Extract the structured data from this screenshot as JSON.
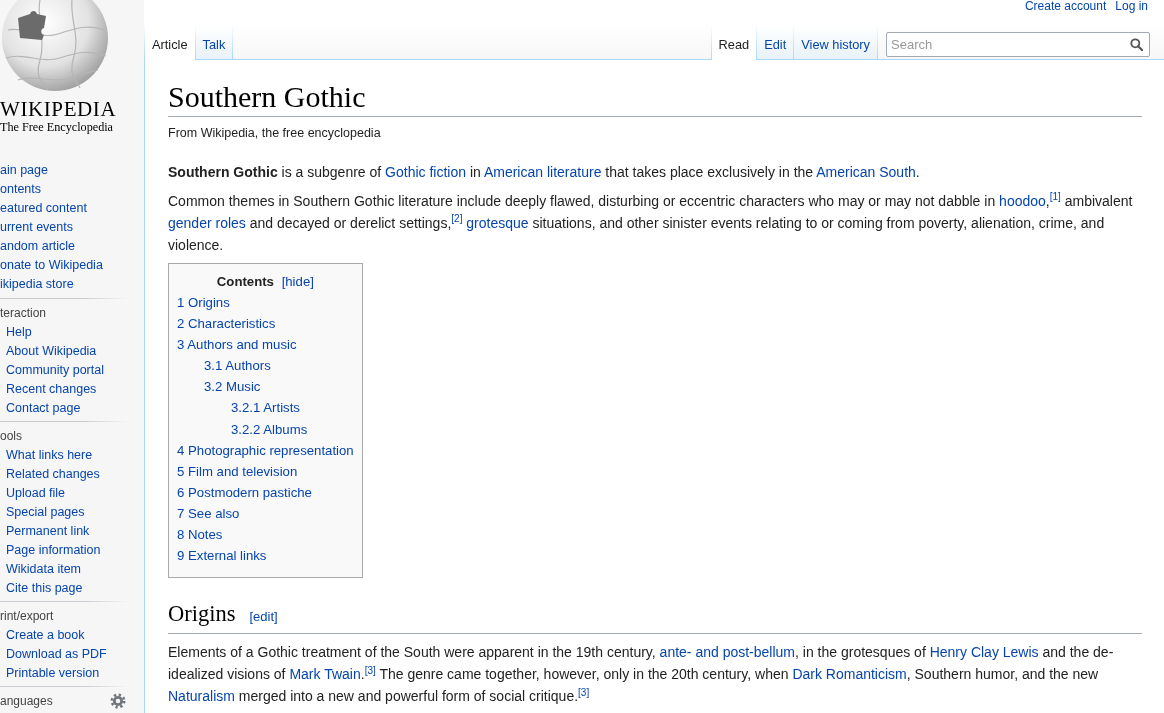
{
  "header": {
    "personal_links": [
      "Create account",
      "Log in"
    ]
  },
  "logo": {
    "wordmark": "WIKIPEDIA",
    "tagline": "The Free Encyclopedia"
  },
  "sidebar": {
    "navigation": [
      "ain page",
      "ontents",
      "eatured content",
      "urrent events",
      "andom article",
      "onate to Wikipedia",
      "ikipedia store"
    ],
    "portals": [
      {
        "heading": "teraction",
        "items": [
          "Help",
          "About Wikipedia",
          "Community portal",
          "Recent changes",
          "Contact page"
        ]
      },
      {
        "heading": "ools",
        "items": [
          "What links here",
          "Related changes",
          "Upload file",
          "Special pages",
          "Permanent link",
          "Page information",
          "Wikidata item",
          "Cite this page"
        ]
      },
      {
        "heading": "rint/export",
        "items": [
          "Create a book",
          "Download as PDF",
          "Printable version"
        ]
      }
    ],
    "languages": {
      "heading": "anguages"
    }
  },
  "namespace_tabs": [
    {
      "label": "Article",
      "selected": true
    },
    {
      "label": "Talk",
      "selected": false
    }
  ],
  "view_tabs": [
    {
      "label": "Read",
      "selected": true
    },
    {
      "label": "Edit",
      "selected": false
    },
    {
      "label": "View history",
      "selected": false
    }
  ],
  "search": {
    "placeholder": "Search"
  },
  "article": {
    "title": "Southern Gothic",
    "tagline": "From Wikipedia, the free encyclopedia",
    "intro": [
      [
        {
          "kind": "bold",
          "text": "Southern Gothic"
        },
        {
          "kind": "text",
          "text": " is a subgenre of "
        },
        {
          "kind": "link",
          "text": "Gothic fiction"
        },
        {
          "kind": "text",
          "text": " in "
        },
        {
          "kind": "link",
          "text": "American literature"
        },
        {
          "kind": "text",
          "text": " that takes place exclusively in the "
        },
        {
          "kind": "link",
          "text": "American South"
        },
        {
          "kind": "text",
          "text": "."
        }
      ],
      [
        {
          "kind": "text",
          "text": "Common themes in Southern Gothic literature include deeply flawed, disturbing or eccentric characters who may or may not dabble in "
        },
        {
          "kind": "link",
          "text": "hoodoo"
        },
        {
          "kind": "text",
          "text": ","
        },
        {
          "kind": "ref",
          "text": "[1]"
        },
        {
          "kind": "text",
          "text": " ambivalent "
        },
        {
          "kind": "link",
          "text": "gender roles"
        },
        {
          "kind": "text",
          "text": " and decayed or derelict settings,"
        },
        {
          "kind": "ref",
          "text": "[2]"
        },
        {
          "kind": "link",
          "text": "grotesque"
        },
        {
          "kind": "text",
          "text": " situations, and other sinister events relating to or coming from poverty, alienation, crime, and violence."
        }
      ]
    ],
    "toc": {
      "title": "Contents",
      "toggle": "[hide]",
      "items": [
        {
          "number": "1",
          "label": "Origins"
        },
        {
          "number": "2",
          "label": "Characteristics"
        },
        {
          "number": "3",
          "label": "Authors and music",
          "children": [
            {
              "number": "3.1",
              "label": "Authors"
            },
            {
              "number": "3.2",
              "label": "Music",
              "children": [
                {
                  "number": "3.2.1",
                  "label": "Artists"
                },
                {
                  "number": "3.2.2",
                  "label": "Albums"
                }
              ]
            }
          ]
        },
        {
          "number": "4",
          "label": "Photographic representation"
        },
        {
          "number": "5",
          "label": "Film and television"
        },
        {
          "number": "6",
          "label": "Postmodern pastiche"
        },
        {
          "number": "7",
          "label": "See also"
        },
        {
          "number": "8",
          "label": "Notes"
        },
        {
          "number": "9",
          "label": "External links"
        }
      ]
    },
    "sections": [
      {
        "heading": "Origins",
        "edit_link": "[edit]",
        "paragraphs": [
          [
            {
              "kind": "text",
              "text": "Elements of a Gothic treatment of the South were apparent in the 19th century, "
            },
            {
              "kind": "link",
              "text": "ante- and post-bellum"
            },
            {
              "kind": "text",
              "text": ", in the grotesques of "
            },
            {
              "kind": "link",
              "text": "Henry Clay Lewis"
            },
            {
              "kind": "text",
              "text": " and the de-idealized visions of "
            },
            {
              "kind": "link",
              "text": "Mark Twain"
            },
            {
              "kind": "text",
              "text": "."
            },
            {
              "kind": "ref",
              "text": "[3]"
            },
            {
              "kind": "text",
              "text": " The genre came together, however, only in the 20th century, when "
            },
            {
              "kind": "link",
              "text": "Dark Romanticism"
            },
            {
              "kind": "text",
              "text": ", Southern humor, and the new "
            },
            {
              "kind": "link",
              "text": "Naturalism"
            },
            {
              "kind": "text",
              "text": " merged into a new and powerful form of social critique."
            },
            {
              "kind": "ref",
              "text": "[3]"
            }
          ]
        ]
      }
    ]
  }
}
